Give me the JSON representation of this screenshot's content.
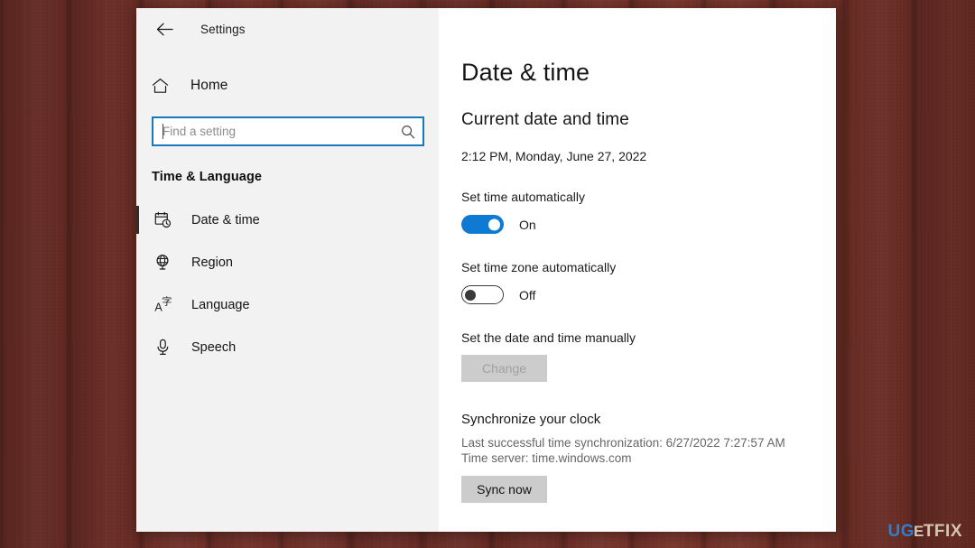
{
  "window": {
    "back_icon": "back-arrow-icon",
    "title": "Settings"
  },
  "sidebar": {
    "home": {
      "label": "Home",
      "icon": "home-icon"
    },
    "search": {
      "placeholder": "Find a setting",
      "value": "",
      "icon": "search-icon"
    },
    "section_title": "Time & Language",
    "items": [
      {
        "label": "Date & time",
        "icon": "calendar-clock-icon",
        "selected": true
      },
      {
        "label": "Region",
        "icon": "globe-icon",
        "selected": false
      },
      {
        "label": "Language",
        "icon": "language-icon",
        "selected": false
      },
      {
        "label": "Speech",
        "icon": "microphone-icon",
        "selected": false
      }
    ]
  },
  "main": {
    "page_title": "Date & time",
    "current_section_heading": "Current date and time",
    "current_datetime": "2:12 PM, Monday, June 27, 2022",
    "set_time_automatically": {
      "label": "Set time automatically",
      "state": "On",
      "on": true
    },
    "set_timezone_automatically": {
      "label": "Set time zone automatically",
      "state": "Off",
      "on": false
    },
    "manual": {
      "label": "Set the date and time manually",
      "button": "Change",
      "enabled": false
    },
    "sync": {
      "heading": "Synchronize your clock",
      "last_sync": "Last successful time synchronization: 6/27/2022 7:27:57 AM",
      "time_server": "Time server: time.windows.com",
      "button": "Sync now",
      "enabled": true
    }
  },
  "watermark": {
    "part1": "UG",
    "part2": "E",
    "part3": "TFIX"
  },
  "colors": {
    "accent_blue": "#0f7ad3",
    "search_border": "#1878be",
    "sidebar_bg": "#f2f2f2",
    "panel_bg": "#ffffff",
    "button_bg": "#cccccc",
    "backdrop": "#6b2d25"
  }
}
